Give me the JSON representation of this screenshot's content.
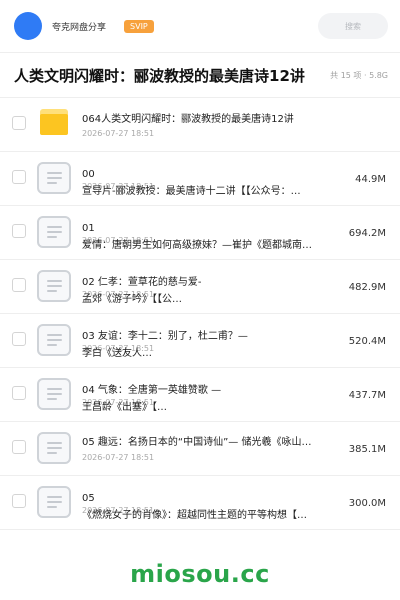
{
  "header": {
    "user_name": "夸克网盘分享",
    "badge": "SVIP",
    "search_placeholder": "搜索"
  },
  "folder": {
    "title": "人类文明闪耀时：郦波教授的最美唐诗12讲",
    "count_text": "共 15 项 · 5.8G"
  },
  "files": [
    {
      "icon": "folder-icon",
      "title": "064人类文明闪耀时：郦波教授的最美唐诗12讲",
      "line2": "",
      "date": "2026-07-27 18:51",
      "size": ""
    },
    {
      "icon": "document-icon",
      "title": "00",
      "line2": "宣导片-郦波教授：最美唐诗十二讲【【公众号：…",
      "date": "2026-07-27 18:51",
      "size": "44.9M"
    },
    {
      "icon": "document-icon",
      "title": "01",
      "line2": "爱情：唐朝男生如何高级撩妹？—崔护《题都城南…",
      "date": "2026-07-27 18:51",
      "size": "694.2M"
    },
    {
      "icon": "document-icon",
      "title": "02 仁孝：萱草花的慈与爱-",
      "line2": "孟郊《游子吟》【【公…",
      "date": "2026-07-27 18:51",
      "size": "482.9M"
    },
    {
      "icon": "document-icon",
      "title": "03 友谊：李十二：别了，杜二甫？—",
      "line2": "李白《送友人…",
      "date": "2026-07-27 18:51",
      "size": "520.4M"
    },
    {
      "icon": "document-icon",
      "title": "04 气象：全唐第一英雄赞歌 —",
      "line2": "王昌龄《出塞》【…",
      "date": "2026-07-27 18:51",
      "size": "437.7M"
    },
    {
      "icon": "document-icon",
      "title": "05 趣远：名扬日本的“中国诗仙”— 储光羲《咏山…",
      "line2": "",
      "date": "2026-07-27 18:51",
      "size": "385.1M"
    },
    {
      "icon": "document-icon",
      "title": "05",
      "line2": "《燃烧女子的肖像》：超越同性主题的平等构想【…",
      "date": "2026-07-27 18:51",
      "size": "300.0M"
    }
  ],
  "watermark": "miosou.cc",
  "colors": {
    "accent_blue": "#2f7bf5",
    "svip_orange": "#f7a13c",
    "folder_yellow": "#fcc521",
    "watermark_green": "#2aa54a"
  }
}
